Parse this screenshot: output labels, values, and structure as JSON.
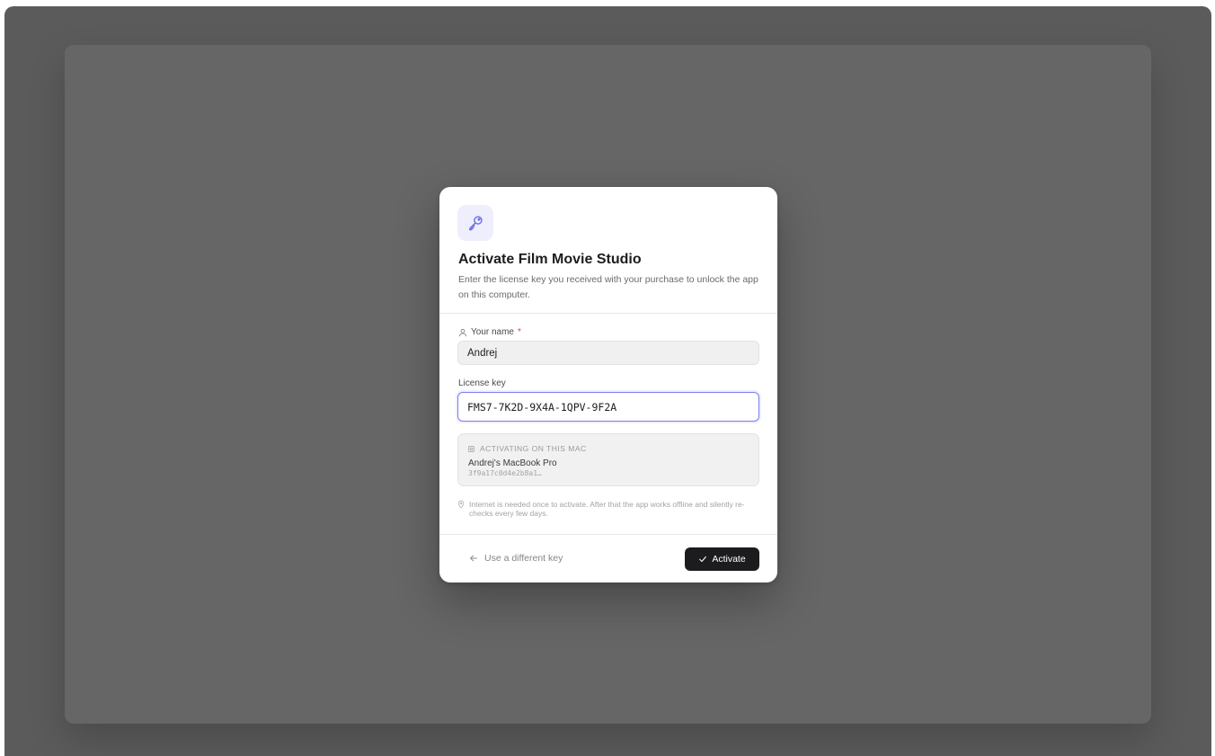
{
  "dialog": {
    "title": "Activate Film Movie Studio",
    "subtitle": "Enter the license key you received with your purchase to unlock the app on this computer.",
    "accent_color": "#7b7ef0"
  },
  "name_field": {
    "label": "Your name",
    "required_mark": "*",
    "value": "Andrej"
  },
  "license_field": {
    "label": "License key",
    "value": "FMS7-7K2D-9X4A-1QPV-9F2A"
  },
  "device": {
    "heading": "ACTIVATING ON THIS MAC",
    "name": "Andrej's MacBook Pro",
    "id": "3f9a17c0d4e2b8a1…"
  },
  "note": {
    "text": "Internet is needed once to activate. After that the app works offline and silently re-checks every few days."
  },
  "footer": {
    "back_label": "Use a different key",
    "activate_label": "Activate"
  },
  "icons": {
    "header": "key-icon",
    "name": "user-icon",
    "device": "chip-icon",
    "note": "info-icon",
    "back": "arrow-left-icon",
    "activate": "check-icon"
  }
}
